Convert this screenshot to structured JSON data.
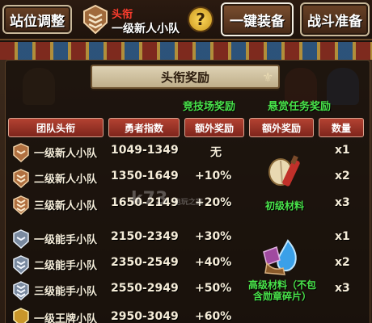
{
  "topbar": {
    "station_label": "站位调整",
    "title_label": "头衔",
    "title_name": "一级新人小队",
    "help_symbol": "?",
    "equip_label": "一键装备",
    "battle_label": "战斗准备"
  },
  "panel": {
    "banner": "头衔奖励",
    "group_arena": "竞技场奖励",
    "group_quest": "悬赏任务奖励",
    "headers": {
      "title": "团队头衔",
      "index": "勇者指数",
      "arena_extra": "额外奖励",
      "quest_extra": "额外奖励",
      "qty": "数量"
    }
  },
  "rows": [
    {
      "name": "一级新人小队",
      "range": "1049-1349",
      "bonus": "无",
      "qty": "x1",
      "tier": "bronze"
    },
    {
      "name": "二级新人小队",
      "range": "1350-1649",
      "bonus": "+10%",
      "qty": "x2",
      "tier": "bronze"
    },
    {
      "name": "三级新人小队",
      "range": "1650-2149",
      "bonus": "+20%",
      "qty": "x3",
      "tier": "bronze"
    },
    {
      "name": "一级能手小队",
      "range": "2150-2349",
      "bonus": "+30%",
      "qty": "x1",
      "tier": "silver"
    },
    {
      "name": "二级能手小队",
      "range": "2350-2549",
      "bonus": "+40%",
      "qty": "x2",
      "tier": "silver"
    },
    {
      "name": "三级能手小队",
      "range": "2550-2949",
      "bonus": "+50%",
      "qty": "x3",
      "tier": "silver"
    },
    {
      "name": "一级王牌小队",
      "range": "2950-3049",
      "bonus": "+60%",
      "qty": "",
      "tier": "gold"
    }
  ],
  "materials": {
    "basic": "初级材料",
    "advanced": "高级材料（不包含勋章碎片）"
  },
  "watermark": {
    "text": "k73",
    "sub": "电玩之家"
  },
  "colors": {
    "accent_green": "#49e34a",
    "title_red": "#ff3d2e",
    "header_red": "#9a3326"
  }
}
